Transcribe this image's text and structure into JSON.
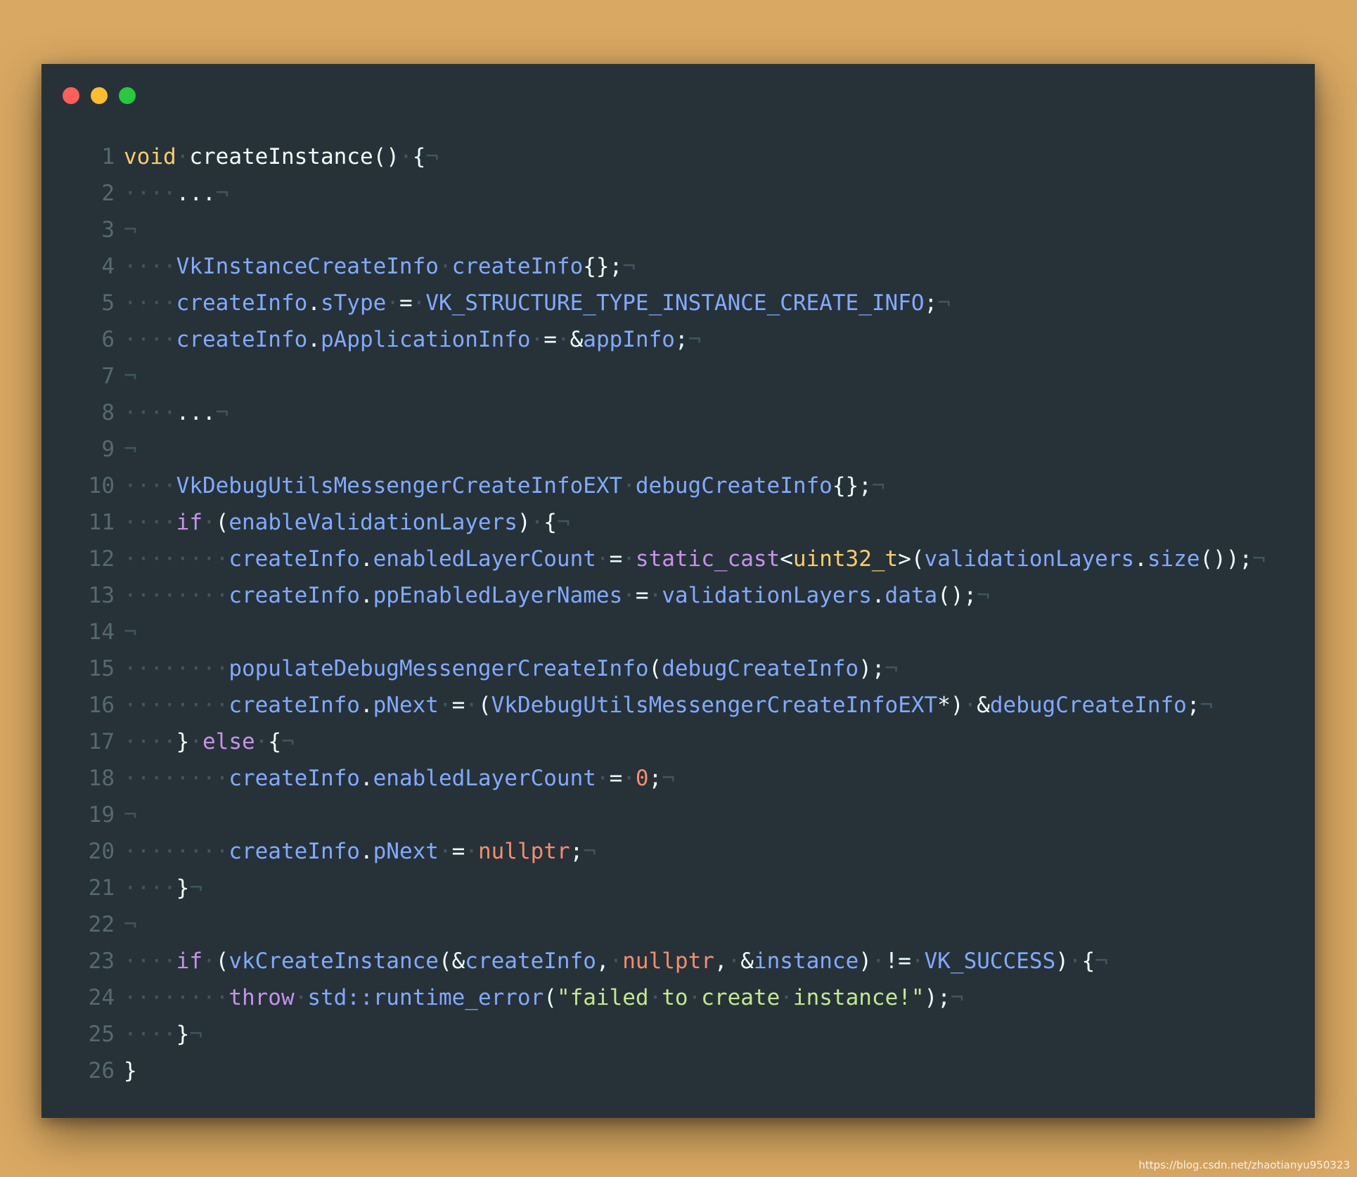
{
  "window": {
    "traffic_lights": [
      {
        "name": "close",
        "color": "#ff5f56"
      },
      {
        "name": "minimize",
        "color": "#ffbd2e"
      },
      {
        "name": "maximize",
        "color": "#27c93f"
      }
    ]
  },
  "colors": {
    "background": "#d9a862",
    "editor_background": "#263238",
    "line_number": "#56696f",
    "whitespace_marker": "#3f5560",
    "keyword": "#c792ea",
    "type": "#ffcb6b",
    "variable": "#82aaff",
    "number": "#f78c6c",
    "string": "#c3e88d",
    "plain": "#eeffff"
  },
  "code": {
    "language": "cpp",
    "lines": [
      {
        "n": "1",
        "tokens": [
          {
            "t": "void",
            "c": "ty"
          },
          {
            "t": "·",
            "c": "ws"
          },
          {
            "t": "createInstance()",
            "c": "pl"
          },
          {
            "t": "·",
            "c": "ws"
          },
          {
            "t": "{",
            "c": "pl"
          },
          {
            "t": "¬",
            "c": "ws"
          }
        ]
      },
      {
        "n": "2",
        "tokens": [
          {
            "t": "····",
            "c": "ws"
          },
          {
            "t": "...",
            "c": "pl"
          },
          {
            "t": "¬",
            "c": "ws"
          }
        ]
      },
      {
        "n": "3",
        "tokens": [
          {
            "t": "¬",
            "c": "ws"
          }
        ]
      },
      {
        "n": "4",
        "tokens": [
          {
            "t": "····",
            "c": "ws"
          },
          {
            "t": "VkInstanceCreateInfo",
            "c": "vr"
          },
          {
            "t": "·",
            "c": "ws"
          },
          {
            "t": "createInfo",
            "c": "vr"
          },
          {
            "t": "{};",
            "c": "pl"
          },
          {
            "t": "¬",
            "c": "ws"
          }
        ]
      },
      {
        "n": "5",
        "tokens": [
          {
            "t": "····",
            "c": "ws"
          },
          {
            "t": "createInfo",
            "c": "vr"
          },
          {
            "t": ".",
            "c": "pl"
          },
          {
            "t": "sType",
            "c": "vr"
          },
          {
            "t": "·",
            "c": "ws"
          },
          {
            "t": "=",
            "c": "pl"
          },
          {
            "t": "·",
            "c": "ws"
          },
          {
            "t": "VK_STRUCTURE_TYPE_INSTANCE_CREATE_INFO",
            "c": "vr"
          },
          {
            "t": ";",
            "c": "pl"
          },
          {
            "t": "¬",
            "c": "ws"
          }
        ]
      },
      {
        "n": "6",
        "tokens": [
          {
            "t": "····",
            "c": "ws"
          },
          {
            "t": "createInfo",
            "c": "vr"
          },
          {
            "t": ".",
            "c": "pl"
          },
          {
            "t": "pApplicationInfo",
            "c": "vr"
          },
          {
            "t": "·",
            "c": "ws"
          },
          {
            "t": "=",
            "c": "pl"
          },
          {
            "t": "·",
            "c": "ws"
          },
          {
            "t": "&",
            "c": "pl"
          },
          {
            "t": "appInfo",
            "c": "vr"
          },
          {
            "t": ";",
            "c": "pl"
          },
          {
            "t": "¬",
            "c": "ws"
          }
        ]
      },
      {
        "n": "7",
        "tokens": [
          {
            "t": "¬",
            "c": "ws"
          }
        ]
      },
      {
        "n": "8",
        "tokens": [
          {
            "t": "····",
            "c": "ws"
          },
          {
            "t": "...",
            "c": "pl"
          },
          {
            "t": "¬",
            "c": "ws"
          }
        ]
      },
      {
        "n": "9",
        "tokens": [
          {
            "t": "¬",
            "c": "ws"
          }
        ]
      },
      {
        "n": "10",
        "tokens": [
          {
            "t": "····",
            "c": "ws"
          },
          {
            "t": "VkDebugUtilsMessengerCreateInfoEXT",
            "c": "vr"
          },
          {
            "t": "·",
            "c": "ws"
          },
          {
            "t": "debugCreateInfo",
            "c": "vr"
          },
          {
            "t": "{};",
            "c": "pl"
          },
          {
            "t": "¬",
            "c": "ws"
          }
        ]
      },
      {
        "n": "11",
        "tokens": [
          {
            "t": "····",
            "c": "ws"
          },
          {
            "t": "if",
            "c": "kw"
          },
          {
            "t": "·",
            "c": "ws"
          },
          {
            "t": "(",
            "c": "pl"
          },
          {
            "t": "enableValidationLayers",
            "c": "vr"
          },
          {
            "t": ")",
            "c": "pl"
          },
          {
            "t": "·",
            "c": "ws"
          },
          {
            "t": "{",
            "c": "pl"
          },
          {
            "t": "¬",
            "c": "ws"
          }
        ]
      },
      {
        "n": "12",
        "tokens": [
          {
            "t": "········",
            "c": "ws"
          },
          {
            "t": "createInfo",
            "c": "vr"
          },
          {
            "t": ".",
            "c": "pl"
          },
          {
            "t": "enabledLayerCount",
            "c": "vr"
          },
          {
            "t": "·",
            "c": "ws"
          },
          {
            "t": "=",
            "c": "pl"
          },
          {
            "t": "·",
            "c": "ws"
          },
          {
            "t": "static_cast",
            "c": "kw"
          },
          {
            "t": "<",
            "c": "pl"
          },
          {
            "t": "uint32_t",
            "c": "ty"
          },
          {
            "t": ">(",
            "c": "pl"
          },
          {
            "t": "validationLayers",
            "c": "vr"
          },
          {
            "t": ".",
            "c": "pl"
          },
          {
            "t": "size",
            "c": "vr"
          },
          {
            "t": "());",
            "c": "pl"
          },
          {
            "t": "¬",
            "c": "ws"
          }
        ]
      },
      {
        "n": "13",
        "tokens": [
          {
            "t": "········",
            "c": "ws"
          },
          {
            "t": "createInfo",
            "c": "vr"
          },
          {
            "t": ".",
            "c": "pl"
          },
          {
            "t": "ppEnabledLayerNames",
            "c": "vr"
          },
          {
            "t": "·",
            "c": "ws"
          },
          {
            "t": "=",
            "c": "pl"
          },
          {
            "t": "·",
            "c": "ws"
          },
          {
            "t": "validationLayers",
            "c": "vr"
          },
          {
            "t": ".",
            "c": "pl"
          },
          {
            "t": "data",
            "c": "vr"
          },
          {
            "t": "();",
            "c": "pl"
          },
          {
            "t": "¬",
            "c": "ws"
          }
        ]
      },
      {
        "n": "14",
        "tokens": [
          {
            "t": "¬",
            "c": "ws"
          }
        ]
      },
      {
        "n": "15",
        "tokens": [
          {
            "t": "········",
            "c": "ws"
          },
          {
            "t": "populateDebugMessengerCreateInfo",
            "c": "vr"
          },
          {
            "t": "(",
            "c": "pl"
          },
          {
            "t": "debugCreateInfo",
            "c": "vr"
          },
          {
            "t": ");",
            "c": "pl"
          },
          {
            "t": "¬",
            "c": "ws"
          }
        ]
      },
      {
        "n": "16",
        "tokens": [
          {
            "t": "········",
            "c": "ws"
          },
          {
            "t": "createInfo",
            "c": "vr"
          },
          {
            "t": ".",
            "c": "pl"
          },
          {
            "t": "pNext",
            "c": "vr"
          },
          {
            "t": "·",
            "c": "ws"
          },
          {
            "t": "=",
            "c": "pl"
          },
          {
            "t": "·",
            "c": "ws"
          },
          {
            "t": "(",
            "c": "pl"
          },
          {
            "t": "VkDebugUtilsMessengerCreateInfoEXT",
            "c": "vr"
          },
          {
            "t": "*)",
            "c": "pl"
          },
          {
            "t": "·",
            "c": "ws"
          },
          {
            "t": "&",
            "c": "pl"
          },
          {
            "t": "debugCreateInfo",
            "c": "vr"
          },
          {
            "t": ";",
            "c": "pl"
          },
          {
            "t": "¬",
            "c": "ws"
          }
        ]
      },
      {
        "n": "17",
        "tokens": [
          {
            "t": "····",
            "c": "ws"
          },
          {
            "t": "}",
            "c": "pl"
          },
          {
            "t": "·",
            "c": "ws"
          },
          {
            "t": "else",
            "c": "kw"
          },
          {
            "t": "·",
            "c": "ws"
          },
          {
            "t": "{",
            "c": "pl"
          },
          {
            "t": "¬",
            "c": "ws"
          }
        ]
      },
      {
        "n": "18",
        "tokens": [
          {
            "t": "········",
            "c": "ws"
          },
          {
            "t": "createInfo",
            "c": "vr"
          },
          {
            "t": ".",
            "c": "pl"
          },
          {
            "t": "enabledLayerCount",
            "c": "vr"
          },
          {
            "t": "·",
            "c": "ws"
          },
          {
            "t": "=",
            "c": "pl"
          },
          {
            "t": "·",
            "c": "ws"
          },
          {
            "t": "0",
            "c": "nm"
          },
          {
            "t": ";",
            "c": "pl"
          },
          {
            "t": "¬",
            "c": "ws"
          }
        ]
      },
      {
        "n": "19",
        "tokens": [
          {
            "t": "¬",
            "c": "ws"
          }
        ]
      },
      {
        "n": "20",
        "tokens": [
          {
            "t": "········",
            "c": "ws"
          },
          {
            "t": "createInfo",
            "c": "vr"
          },
          {
            "t": ".",
            "c": "pl"
          },
          {
            "t": "pNext",
            "c": "vr"
          },
          {
            "t": "·",
            "c": "ws"
          },
          {
            "t": "=",
            "c": "pl"
          },
          {
            "t": "·",
            "c": "ws"
          },
          {
            "t": "nullptr",
            "c": "nm"
          },
          {
            "t": ";",
            "c": "pl"
          },
          {
            "t": "¬",
            "c": "ws"
          }
        ]
      },
      {
        "n": "21",
        "tokens": [
          {
            "t": "····",
            "c": "ws"
          },
          {
            "t": "}",
            "c": "pl"
          },
          {
            "t": "¬",
            "c": "ws"
          }
        ]
      },
      {
        "n": "22",
        "tokens": [
          {
            "t": "¬",
            "c": "ws"
          }
        ]
      },
      {
        "n": "23",
        "tokens": [
          {
            "t": "····",
            "c": "ws"
          },
          {
            "t": "if",
            "c": "kw"
          },
          {
            "t": "·",
            "c": "ws"
          },
          {
            "t": "(",
            "c": "pl"
          },
          {
            "t": "vkCreateInstance",
            "c": "vr"
          },
          {
            "t": "(&",
            "c": "pl"
          },
          {
            "t": "createInfo",
            "c": "vr"
          },
          {
            "t": ",",
            "c": "pl"
          },
          {
            "t": "·",
            "c": "ws"
          },
          {
            "t": "nullptr",
            "c": "nm"
          },
          {
            "t": ",",
            "c": "pl"
          },
          {
            "t": "·",
            "c": "ws"
          },
          {
            "t": "&",
            "c": "pl"
          },
          {
            "t": "instance",
            "c": "vr"
          },
          {
            "t": ")",
            "c": "pl"
          },
          {
            "t": "·",
            "c": "ws"
          },
          {
            "t": "!=",
            "c": "pl"
          },
          {
            "t": "·",
            "c": "ws"
          },
          {
            "t": "VK_SUCCESS",
            "c": "vr"
          },
          {
            "t": ")",
            "c": "pl"
          },
          {
            "t": "·",
            "c": "ws"
          },
          {
            "t": "{",
            "c": "pl"
          },
          {
            "t": "¬",
            "c": "ws"
          }
        ]
      },
      {
        "n": "24",
        "tokens": [
          {
            "t": "········",
            "c": "ws"
          },
          {
            "t": "throw",
            "c": "kw"
          },
          {
            "t": "·",
            "c": "ws"
          },
          {
            "t": "std::runtime_error",
            "c": "vr"
          },
          {
            "t": "(",
            "c": "pl"
          },
          {
            "t": "\"failed",
            "c": "st"
          },
          {
            "t": "·",
            "c": "ws"
          },
          {
            "t": "to",
            "c": "st"
          },
          {
            "t": "·",
            "c": "ws"
          },
          {
            "t": "create",
            "c": "st"
          },
          {
            "t": "·",
            "c": "ws"
          },
          {
            "t": "instance!\"",
            "c": "st"
          },
          {
            "t": ");",
            "c": "pl"
          },
          {
            "t": "¬",
            "c": "ws"
          }
        ]
      },
      {
        "n": "25",
        "tokens": [
          {
            "t": "····",
            "c": "ws"
          },
          {
            "t": "}",
            "c": "pl"
          },
          {
            "t": "¬",
            "c": "ws"
          }
        ]
      },
      {
        "n": "26",
        "tokens": [
          {
            "t": "}",
            "c": "pl"
          }
        ]
      }
    ]
  },
  "watermark": "https://blog.csdn.net/zhaotianyu950323"
}
